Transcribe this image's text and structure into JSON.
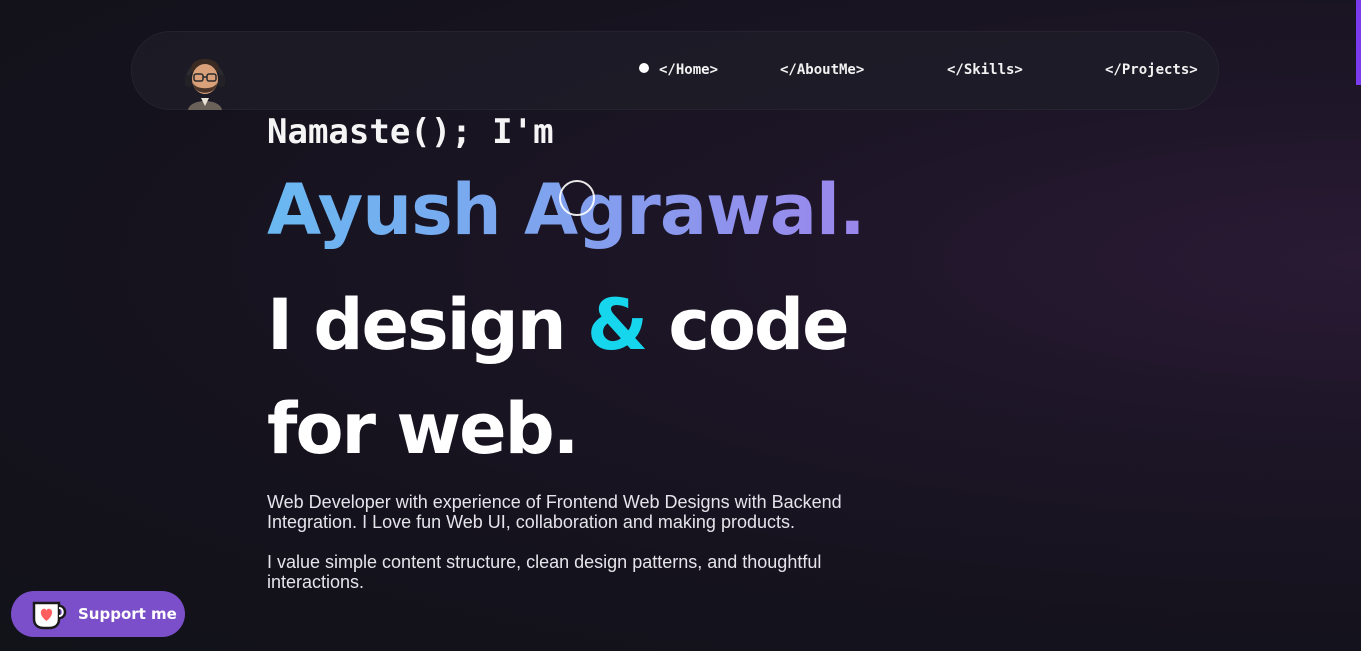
{
  "nav": {
    "avatar_icon": "avatar-memoji",
    "links": [
      {
        "label": "</Home>",
        "active": true
      },
      {
        "label": "</AboutMe>",
        "active": false
      },
      {
        "label": "</Skills>",
        "active": false
      },
      {
        "label": "</Projects>",
        "active": false
      }
    ]
  },
  "hero": {
    "greeting": "Namaste(); I'm",
    "name": "Ayush Agrawal.",
    "tagline_part1": "I design ",
    "tagline_amp": "&",
    "tagline_part2": " code for web.",
    "bio_1": "Web Developer with experience of Frontend Web Designs with Backend Integration. I Love fun Web UI, collaboration and making products.",
    "bio_2": "I value simple content structure, clean design patterns, and thoughtful interactions."
  },
  "support": {
    "label": "Support me",
    "icon": "kofi-cup-heart-icon"
  },
  "colors": {
    "background": "#14121c",
    "accent_cyan": "#16d6ee",
    "name_gradient_start": "#6ab8f2",
    "name_gradient_end": "#9b86ec",
    "support_button": "#7b4fc9",
    "scroll_accent": "#7c3aed"
  }
}
